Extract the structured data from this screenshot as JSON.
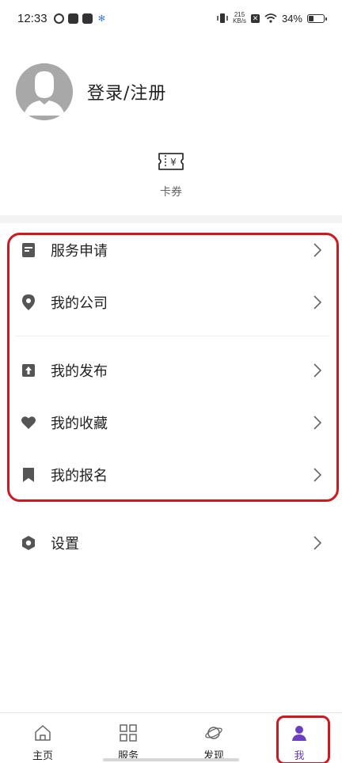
{
  "status_bar": {
    "time": "12:33",
    "net_speed_top": "215",
    "net_speed_bottom": "KB/s",
    "battery": "34%"
  },
  "profile": {
    "login_label": "登录/注册"
  },
  "coupon": {
    "label": "卡券",
    "icon_symbol": "¥"
  },
  "menu": {
    "items": [
      {
        "label": "服务申请",
        "icon": "document-icon"
      },
      {
        "label": "我的公司",
        "icon": "location-pin-icon"
      },
      {
        "label": "我的发布",
        "icon": "upload-icon"
      },
      {
        "label": "我的收藏",
        "icon": "heart-icon"
      },
      {
        "label": "我的报名",
        "icon": "bookmark-icon"
      },
      {
        "label": "设置",
        "icon": "settings-hex-icon"
      }
    ]
  },
  "bottom_nav": {
    "items": [
      {
        "label": "主页",
        "icon": "home-icon"
      },
      {
        "label": "服务",
        "icon": "grid-icon"
      },
      {
        "label": "发现",
        "icon": "planet-icon"
      },
      {
        "label": "我",
        "icon": "user-icon",
        "active": true
      }
    ]
  },
  "colors": {
    "accent": "#6b3fc4",
    "highlight": "#d0181f",
    "icon_gray": "#555555"
  }
}
